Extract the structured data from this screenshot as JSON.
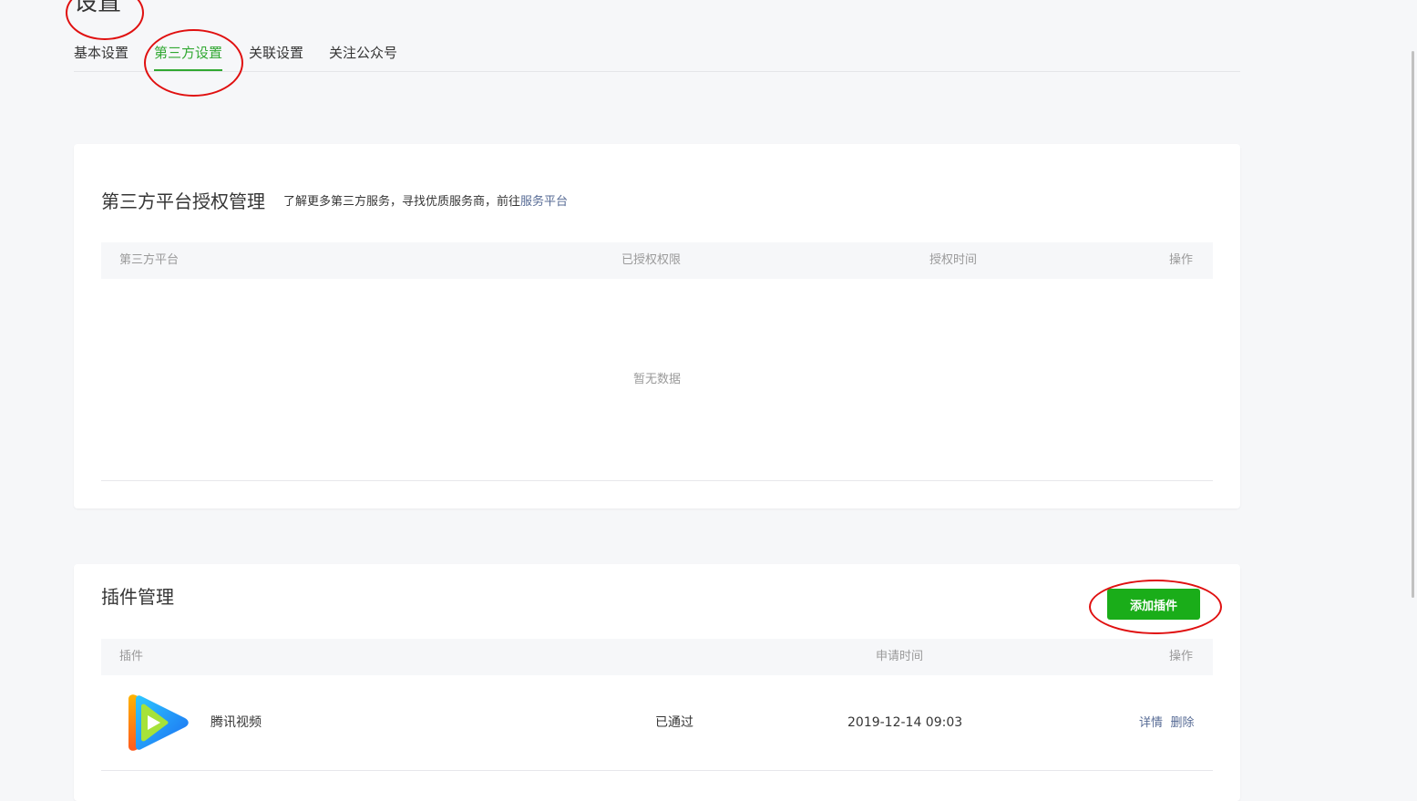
{
  "header": {
    "title": "设置"
  },
  "tabs": [
    {
      "label": "基本设置",
      "active": false
    },
    {
      "label": "第三方设置",
      "active": true
    },
    {
      "label": "关联设置",
      "active": false
    },
    {
      "label": "关注公众号",
      "active": false
    }
  ],
  "auth_section": {
    "title": "第三方平台授权管理",
    "desc_prefix": "了解更多第三方服务，寻找优质服务商，前往",
    "desc_link": "服务平台",
    "columns": [
      "第三方平台",
      "已授权权限",
      "授权时间",
      "操作"
    ],
    "empty_text": "暂无数据"
  },
  "plugin_section": {
    "title": "插件管理",
    "add_button_label": "添加插件",
    "columns": [
      "插件",
      "申请时间",
      "操作"
    ],
    "rows": [
      {
        "name": "腾讯视频",
        "icon": "tencent-video-logo",
        "status": "已通过",
        "apply_time": "2019-12-14 09:03",
        "actions": [
          "详情",
          "删除"
        ]
      }
    ]
  },
  "colors": {
    "accent_green": "#31a832",
    "button_green": "#1aad19",
    "link_blue": "#576b95",
    "annotation_red": "#e01010",
    "background": "#f6f7f9"
  }
}
